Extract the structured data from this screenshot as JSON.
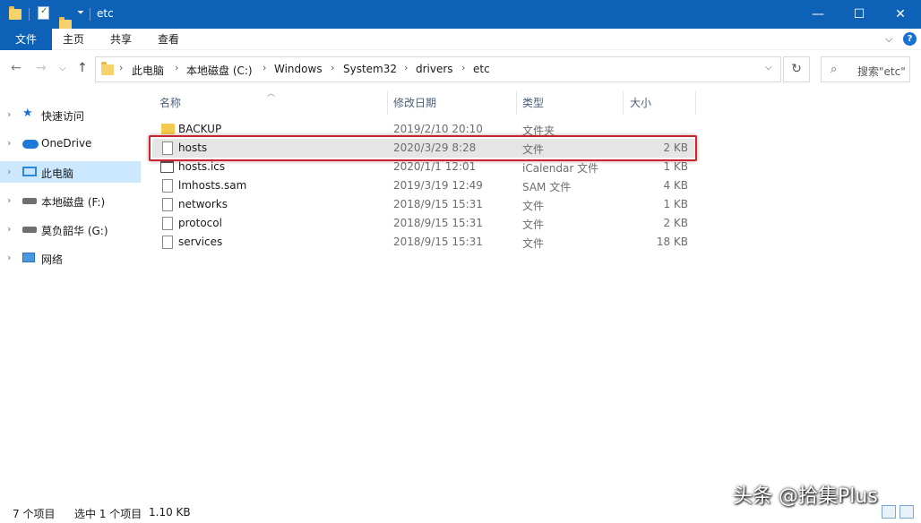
{
  "window": {
    "title": "etc",
    "minimize": "—",
    "maximize": "☐",
    "close": "✕"
  },
  "ribbon": {
    "tabs": [
      "文件",
      "主页",
      "共享",
      "查看"
    ],
    "collapse": "⌵",
    "help": "?"
  },
  "nav": {
    "back": "←",
    "forward": "→",
    "recent": "⌵",
    "up": "↑"
  },
  "address": {
    "breadcrumbs": [
      "此电脑",
      "本地磁盘 (C:)",
      "Windows",
      "System32",
      "drivers",
      "etc"
    ],
    "dropdown": "⌵",
    "refresh": "↻"
  },
  "search": {
    "placeholder": "搜索\"etc\""
  },
  "sidebar": {
    "items": [
      {
        "label": "快速访问",
        "icon": "star-icon"
      },
      {
        "label": "OneDrive",
        "icon": "cloud-icon"
      },
      {
        "label": "此电脑",
        "icon": "pc-icon",
        "selected": true
      },
      {
        "label": "本地磁盘 (F:)",
        "icon": "drive-icon"
      },
      {
        "label": "莫负韶华 (G:)",
        "icon": "drive-icon"
      },
      {
        "label": "网络",
        "icon": "network-icon"
      }
    ]
  },
  "columns": {
    "name": "名称",
    "date": "修改日期",
    "type": "类型",
    "size": "大小"
  },
  "files": [
    {
      "name": "BACKUP",
      "date": "2019/2/10 20:10",
      "type": "文件夹",
      "size": "",
      "icon": "folder-icon"
    },
    {
      "name": "hosts",
      "date": "2020/3/29 8:28",
      "type": "文件",
      "size": "2 KB",
      "icon": "file-icon",
      "selected": true
    },
    {
      "name": "hosts.ics",
      "date": "2020/1/1 12:01",
      "type": "iCalendar 文件",
      "size": "1 KB",
      "icon": "calendar-file-icon"
    },
    {
      "name": "lmhosts.sam",
      "date": "2019/3/19 12:49",
      "type": "SAM 文件",
      "size": "4 KB",
      "icon": "file-icon"
    },
    {
      "name": "networks",
      "date": "2018/9/15 15:31",
      "type": "文件",
      "size": "1 KB",
      "icon": "file-icon"
    },
    {
      "name": "protocol",
      "date": "2018/9/15 15:31",
      "type": "文件",
      "size": "2 KB",
      "icon": "file-icon"
    },
    {
      "name": "services",
      "date": "2018/9/15 15:31",
      "type": "文件",
      "size": "18 KB",
      "icon": "file-icon"
    }
  ],
  "status": {
    "count": "7 个项目",
    "selected": "选中 1 个项目",
    "size": "1.10 KB"
  },
  "watermark": "头条 @拾集Plus",
  "colors": {
    "titlebar": "#0d62b8",
    "selection": "#cce8ff",
    "highlight": "#c6262e"
  }
}
